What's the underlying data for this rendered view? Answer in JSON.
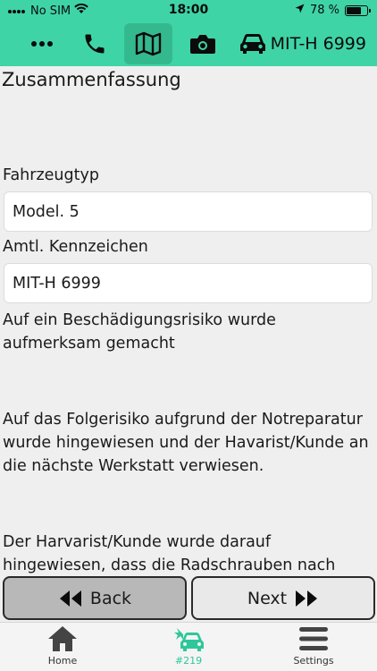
{
  "status": {
    "carrier": "No SIM",
    "time": "18:00",
    "battery": "78 %",
    "battery_level": 0.78
  },
  "toolbar": {
    "plate": "MIT-H 6999",
    "icons": [
      "more-icon",
      "phone-icon",
      "map-icon",
      "camera-icon",
      "car-icon"
    ]
  },
  "page": {
    "title": "Zusammenfassung"
  },
  "form": {
    "vehicle_type_label": "Fahrzeugtyp",
    "vehicle_type_value": "Model. 5",
    "plate_label": "Amtl. Kennzeichen",
    "plate_value": "MIT-H 6999"
  },
  "notes": {
    "p1": "Auf ein Beschädigungsrisiko wurde aufmerksam gemacht",
    "p2": "Auf das Folgerisiko aufgrund der Notreparatur wurde hingewiesen und der Havarist/Kunde an die nächste Werkstatt verwiesen.",
    "p3": "Der Harvarist/Kunde wurde darauf hingewiesen, dass die Radschrauben nach"
  },
  "nav": {
    "back": "Back",
    "next": "Next"
  },
  "tabs": [
    {
      "label": "Home",
      "icon": "home-icon"
    },
    {
      "label": "#219",
      "icon": "car-crash-icon"
    },
    {
      "label": "Settings",
      "icon": "menu-icon"
    }
  ],
  "colors": {
    "accent": "#3fd4a6",
    "accent_dark": "#2fc79a"
  }
}
